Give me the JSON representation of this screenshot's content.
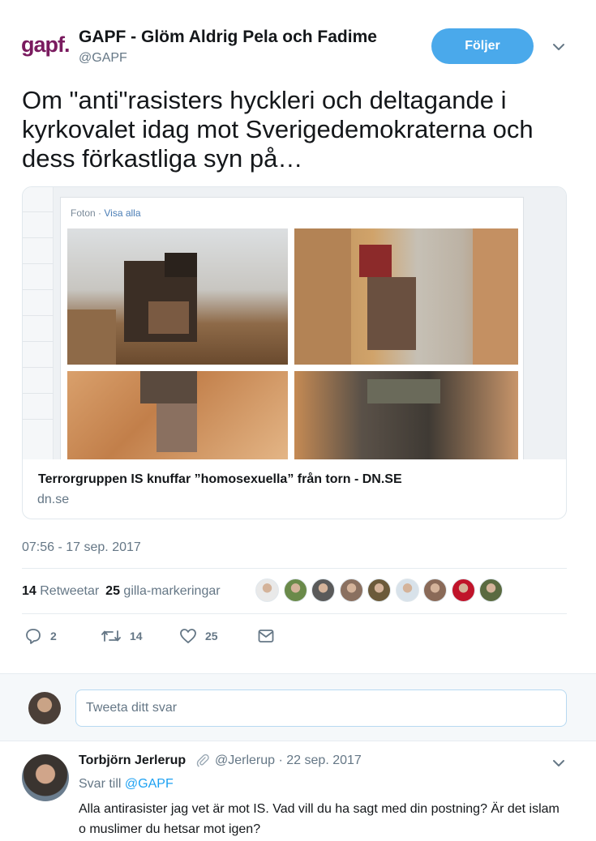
{
  "tweet": {
    "author_name": "GAPF - Glöm Aldrig Pela och Fadime",
    "author_handle": "@GAPF",
    "logo_text": "gapf.",
    "follow_label": "Följer",
    "text": "Om \"anti\"rasisters hyckleri och deltagande i kyrkovalet idag mot Sverigedemokraterna och dess förkastliga syn på…",
    "timestamp": "07:56 - 17 sep. 2017"
  },
  "card": {
    "image_header_label": "Foton",
    "image_header_sep": " · ",
    "image_header_link": "Visa alla",
    "title": "Terrorgruppen IS knuffar ”homosexuella” från torn - DN.SE",
    "domain": "dn.se"
  },
  "stats": {
    "retweets_count": "14",
    "retweets_label": "Retweetar",
    "likes_count": "25",
    "likes_label": "gilla-markeringar"
  },
  "liker_avatar_colors": [
    "#e9e9e9",
    "#6a8a4a",
    "#5a5a5a",
    "#8a7060",
    "#6b5a3a",
    "#d8e2ea",
    "#8a6a58",
    "#c0142a",
    "#5a6a40"
  ],
  "actions": {
    "reply_count": "2",
    "retweet_count": "14",
    "like_count": "25"
  },
  "reply_box": {
    "placeholder": "Tweeta ditt svar"
  },
  "reply": {
    "author_name": "Torbjörn Jerlerup",
    "author_handle": "@Jerlerup",
    "date": "· 22 sep. 2017",
    "reply_to_prefix": "Svar till ",
    "reply_to_mention": "@GAPF",
    "text": "Alla antirasister jag vet är mot IS. Vad vill du ha sagt med din postning? Är det islam o muslimer du hetsar mot igen?"
  },
  "colors": {
    "accent": "#1da1f2",
    "follow_button": "#4aa9eb",
    "logo": "#7a1b5f",
    "secondary_text": "#657786"
  }
}
